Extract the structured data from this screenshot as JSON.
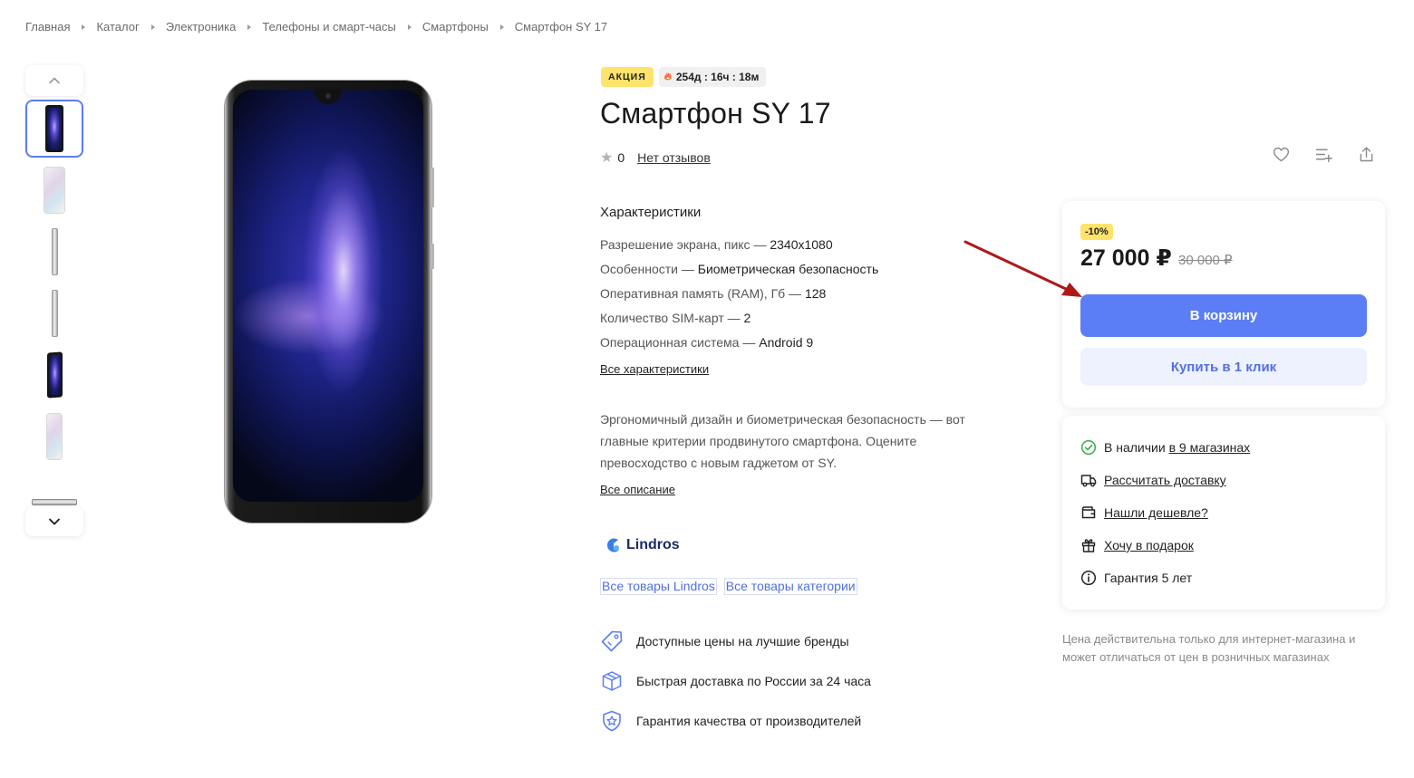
{
  "breadcrumbs": [
    "Главная",
    "Каталог",
    "Электроника",
    "Телефоны и смарт-часы",
    "Смартфоны",
    "Смартфон SY 17"
  ],
  "badges": {
    "sale": "АКЦИЯ",
    "timer": "254д : 16ч : 18м"
  },
  "product": {
    "title": "Смартфон SY 17",
    "rating_value": "0",
    "reviews_link": "Нет отзывов"
  },
  "specs": {
    "heading": "Характеристики",
    "items": [
      {
        "label": "Разрешение экрана, пикс — ",
        "value": "2340x1080"
      },
      {
        "label": "Особенности — ",
        "value": "Биометрическая безопасность"
      },
      {
        "label": "Оперативная память (RAM), Гб — ",
        "value": "128"
      },
      {
        "label": "Количество SIM-карт — ",
        "value": "2"
      },
      {
        "label": "Операционная система — ",
        "value": "Android 9"
      }
    ],
    "all_link": "Все характеристики"
  },
  "description": {
    "text": "Эргономичный дизайн и биометрическая безопасность — вот главные критерии продвинутого смартфона. Оцените превосходство с новым гаджетом от SY.",
    "all_link": "Все описание"
  },
  "brand": {
    "name": "Lindros",
    "links": [
      "Все товары Lindros",
      "Все товары категории"
    ]
  },
  "perks": [
    {
      "icon": "price-tag-icon",
      "text": "Доступные цены на лучшие бренды"
    },
    {
      "icon": "box-icon",
      "text": "Быстрая доставка по России за 24 часа"
    },
    {
      "icon": "quality-shield-icon",
      "text": "Гарантия качества от производителей"
    }
  ],
  "buy": {
    "discount": "-10%",
    "price": "27 000 ₽",
    "old_price": "30 000 ₽",
    "cart_button": "В корзину",
    "one_click_button": "Купить в 1 клик"
  },
  "info": {
    "stock_prefix": "В наличии ",
    "stock_link": "в 9 магазинах",
    "delivery": "Рассчитать доставку",
    "cheaper": "Нашли дешевле?",
    "gift": "Хочу в подарок",
    "warranty": "Гарантия 5 лет"
  },
  "note": "Цена действительна только для интернет-магазина и может отличаться от цен в розничных магазинах",
  "colors": {
    "accent": "#5b7df5",
    "badge_yellow": "#ffe36b",
    "in_stock_green": "#3cb34a",
    "annotation_arrow": "#b01818"
  },
  "icons": [
    "chevron-up-icon",
    "chevron-down-icon",
    "star-icon",
    "heart-icon",
    "compare-list-icon",
    "share-icon",
    "fire-icon",
    "lindros-logo-icon",
    "check-circle-icon",
    "truck-icon",
    "wallet-icon",
    "gift-icon",
    "info-icon"
  ]
}
